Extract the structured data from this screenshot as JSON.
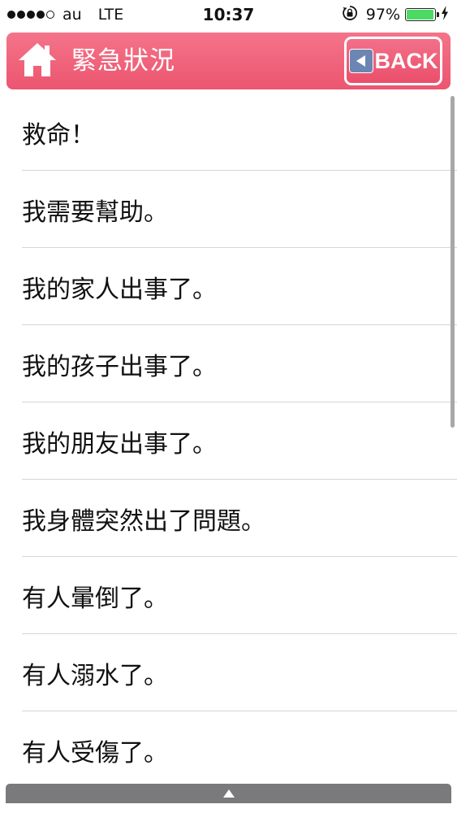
{
  "status_bar": {
    "signal_dots_filled": 4,
    "signal_dots_total": 5,
    "carrier": "au",
    "network": "LTE",
    "time": "10:37",
    "battery_percent": "97%",
    "battery_level": 0.97,
    "icons": [
      "signal-icon",
      "rotation-lock-icon",
      "battery-icon",
      "charging-icon"
    ]
  },
  "header": {
    "title": "緊急狀況",
    "home_icon": "home-icon",
    "back_label": "BACK",
    "back_icon": "back-arrow-icon",
    "color": "#ee5d75"
  },
  "list": {
    "items": [
      {
        "label": "救命！"
      },
      {
        "label": "我需要幫助。"
      },
      {
        "label": "我的家人出事了。"
      },
      {
        "label": "我的孩子出事了。"
      },
      {
        "label": "我的朋友出事了。"
      },
      {
        "label": "我身體突然出了問題。"
      },
      {
        "label": "有人暈倒了。"
      },
      {
        "label": "有人溺水了。"
      },
      {
        "label": "有人受傷了。"
      }
    ]
  },
  "bottom_bar": {
    "icon": "expand-up-icon"
  }
}
